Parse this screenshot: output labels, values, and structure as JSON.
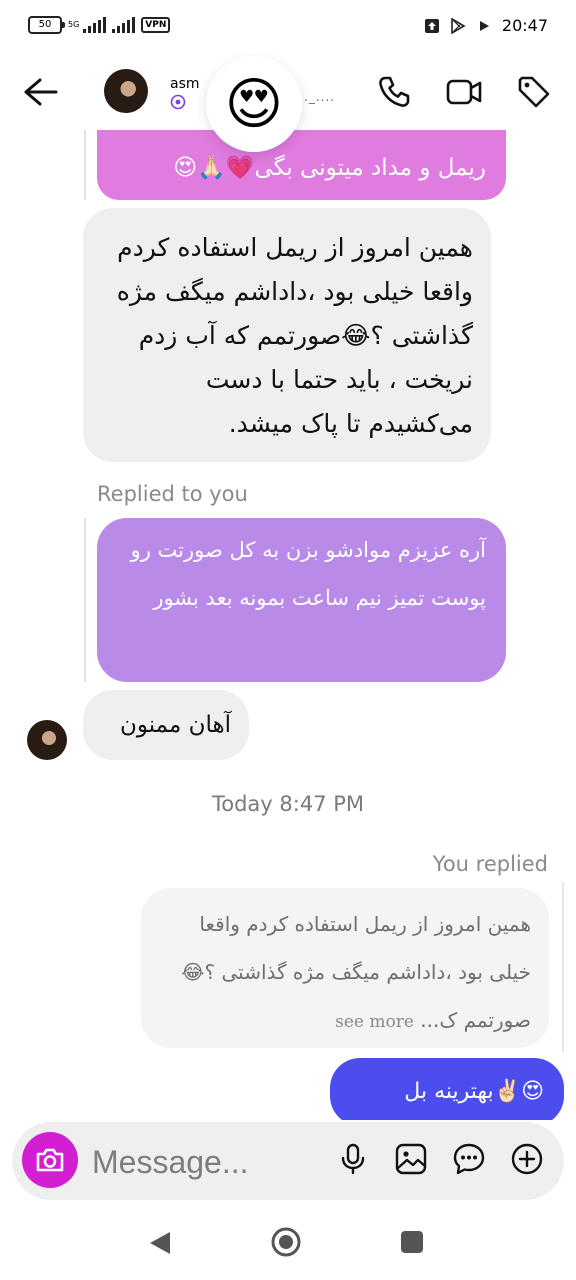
{
  "status_bar": {
    "battery": "50",
    "network": "5G",
    "vpn": "VPN",
    "time": "20:47"
  },
  "header": {
    "contact_name": "asm",
    "reaction_emoji": "😍",
    "typing_dots": "._...."
  },
  "messages": {
    "pink_text": "ریمل و مداد میتونی بگی💗🙏🏻😍",
    "gray1_text": "همین امروز از ریمل استفاده کردم واقعا خیلی بود ،داداشم میگف مژه گذاشتی ؟😂صورتمم که آب زدم نریخت ، باید حتما با دست می‌کشیدم تا پاک میشد.",
    "replied_label": "Replied to you",
    "purple_text": "آره عزیزم موادشو بزن به کل صورتت رو پوست تمیز نیم ساعت بمونه بعد بشور",
    "gray2_text": "آهان ممنون",
    "timestamp": "Today 8:47 PM",
    "you_replied_label": "You replied",
    "quote_text": "همین امروز از ریمل استفاده کردم واقعا خیلی بود ،داداشم میگف مژه گذاشتی ؟😂صورتمم ک...",
    "see_more": "see more",
    "mine_text": "😍✌🏻بهترینه بل"
  },
  "composer": {
    "placeholder": "Message..."
  },
  "colors": {
    "pink": "#e07be0",
    "purple": "#b98ae8",
    "mine": "#4b4ded",
    "camera": "#d21fd2"
  }
}
